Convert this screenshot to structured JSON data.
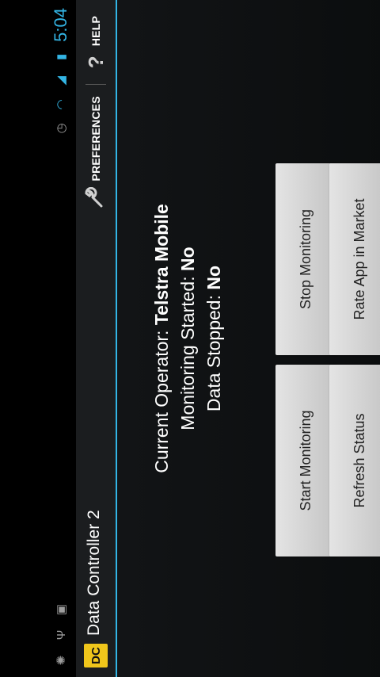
{
  "status_bar": {
    "time": "5:04",
    "left_icons": [
      "android-debug-icon",
      "usb-icon",
      "sd-card-icon"
    ],
    "right_icons": [
      "alarm-icon",
      "wifi-icon",
      "signal-icon",
      "battery-icon"
    ]
  },
  "action_bar": {
    "logo_text": "DC",
    "title": "Data Controller 2",
    "preferences_label": "PREFERENCES",
    "help_label": "HELP"
  },
  "status": {
    "operator_label": "Current Operator:",
    "operator_value": "Telstra Mobile",
    "monitoring_label": "Monitoring Started:",
    "monitoring_value": "No",
    "data_label": "Data Stopped:",
    "data_value": "No"
  },
  "buttons": {
    "start": "Start Monitoring",
    "stop": "Stop Monitoring",
    "refresh": "Refresh Status",
    "rate": "Rate App in Market"
  },
  "nav": {
    "icons": [
      "recent-apps-icon",
      "home-icon",
      "back-icon"
    ]
  },
  "colors": {
    "accent": "#33b5e5",
    "logo": "#f0c61b"
  }
}
